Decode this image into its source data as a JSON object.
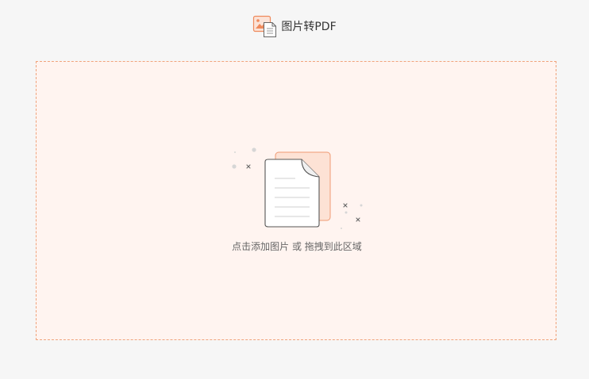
{
  "header": {
    "title": "图片转PDF",
    "icon": "image-to-pdf-icon"
  },
  "drop_zone": {
    "hint": "点击添加图片 或 拖拽到此区域",
    "icon": "document-upload-icon",
    "accent_color": "#f0a37c",
    "background_color": "#fff4f0"
  }
}
